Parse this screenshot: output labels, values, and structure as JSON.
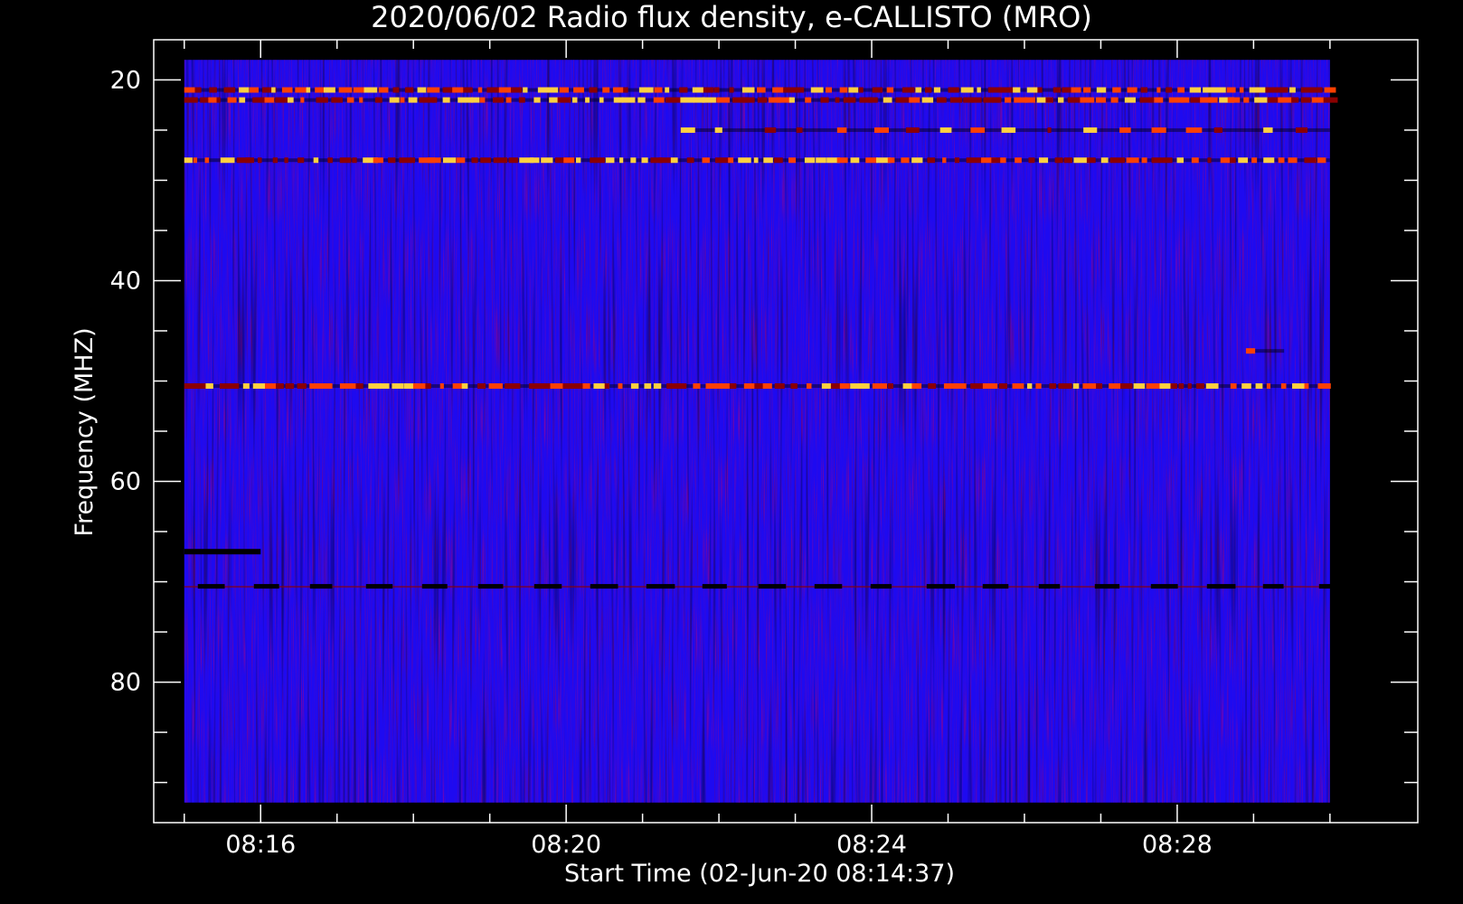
{
  "chart_data": {
    "type": "heatmap",
    "title": "2020/06/02  Radio flux density, e-CALLISTO (MRO)",
    "xlabel": "Start Time (02-Jun-20 08:14:37)",
    "ylabel": "Frequency (MHZ)",
    "x_axis": {
      "unit": "minutes after 08:00",
      "range": [
        14.6,
        31.15
      ],
      "data_range": [
        15.0,
        30.0
      ],
      "major_ticks": [
        16,
        20,
        24,
        28
      ],
      "tick_labels": [
        "08:16",
        "08:20",
        "08:24",
        "08:28"
      ],
      "minor_tick_step": 1
    },
    "y_axis": {
      "unit": "MHz",
      "inverted": true,
      "range": [
        16,
        94
      ],
      "data_range": [
        18,
        92
      ],
      "major_ticks": [
        20,
        40,
        60,
        80
      ],
      "tick_labels": [
        "20",
        "40",
        "60",
        "80"
      ],
      "minor_tick_step": 5
    },
    "colormap": [
      "#000000",
      "#0000ff",
      "#8b0000",
      "#ff4000",
      "#ffd040"
    ],
    "background": "#1e0af0",
    "features": [
      {
        "kind": "interference-line",
        "freq": 21.0,
        "intensity": "high",
        "time_from": 15.0,
        "time_to": 30.0
      },
      {
        "kind": "interference-line",
        "freq": 22.0,
        "intensity": "high",
        "time_from": 15.0,
        "time_to": 30.0
      },
      {
        "kind": "interference-line",
        "freq": 25.0,
        "intensity": "medium",
        "time_from": 21.5,
        "time_to": 30.0
      },
      {
        "kind": "interference-line",
        "freq": 28.0,
        "intensity": "high",
        "time_from": 15.0,
        "time_to": 30.0
      },
      {
        "kind": "interference-line",
        "freq": 50.5,
        "intensity": "high",
        "time_from": 15.0,
        "time_to": 30.0
      },
      {
        "kind": "interference-line",
        "freq": 47.0,
        "intensity": "medium",
        "time_from": 28.9,
        "time_to": 29.4
      },
      {
        "kind": "dark-line",
        "freq": 70.5,
        "time_from": 15.0,
        "time_to": 30.0
      },
      {
        "kind": "dark-line",
        "freq": 67.0,
        "time_from": 15.0,
        "time_to": 16.0
      }
    ]
  }
}
